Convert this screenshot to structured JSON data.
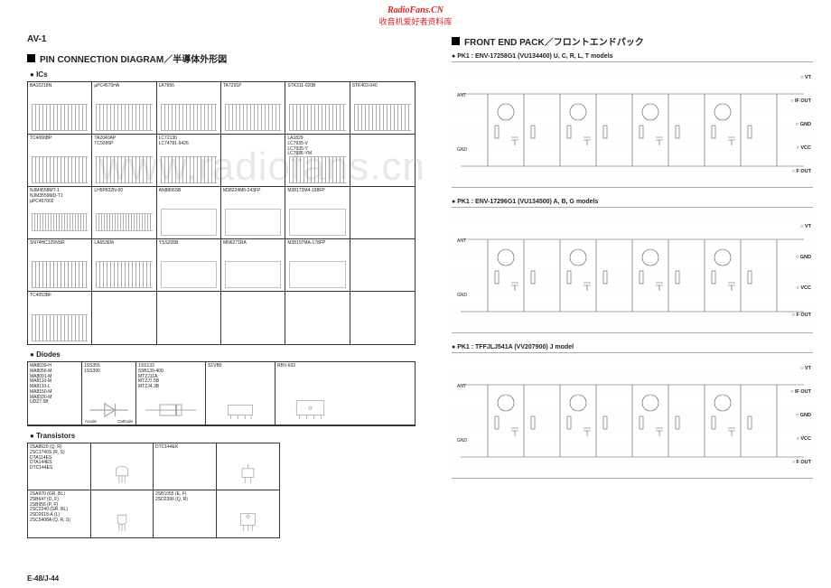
{
  "watermark": {
    "site": "RadioFans.CN",
    "tagline": "收音机爱好者资料库",
    "bg": "www.radiofans.cn"
  },
  "model": "AV-1",
  "page_footer": "E-48/J-44",
  "left": {
    "title": "PIN CONNECTION DIAGRAM／半導体外形図",
    "ic_heading": "ICs",
    "ic_rows": [
      [
        {
          "labels": [
            "BA10218N"
          ]
        },
        {
          "labels": [
            "µPC4570HA"
          ]
        },
        {
          "labels": [
            "LA7956"
          ]
        },
        {
          "labels": [
            "TA7291P"
          ]
        },
        {
          "labels": [
            "STK311-020B"
          ]
        },
        {
          "labels": [
            "STK403-040"
          ]
        }
      ],
      [
        {
          "labels": [
            "TC4066BP"
          ]
        },
        {
          "labels": [
            "TA2040AP",
            "TC9286P"
          ]
        },
        {
          "labels": [
            "LC72130",
            "LC74781-9426"
          ]
        },
        {
          "labels": [
            ""
          ],
          "empty": true
        },
        {
          "labels": [
            "LA1829",
            "LC7935-V",
            "LC7935-Y",
            "LC7935-YM"
          ]
        },
        {
          "labels": [
            ""
          ],
          "empty": true
        }
      ],
      [
        {
          "labels": [
            "NJM4558MT-1",
            "NJM3559MD-T1",
            "µPC457002"
          ]
        },
        {
          "labels": [
            "LH5P832N-00"
          ]
        },
        {
          "labels": [
            "AN8806SB"
          ]
        },
        {
          "labels": [
            "M38224M6-243FP"
          ]
        },
        {
          "labels": [
            "M38172M4-198FP"
          ]
        },
        {
          "labels": [
            ""
          ],
          "empty": true
        }
      ],
      [
        {
          "labels": [
            "SN74HC125NSR"
          ]
        },
        {
          "labels": [
            "LA6536M"
          ]
        },
        {
          "labels": [
            "YSS205B"
          ]
        },
        {
          "labels": [
            "MN6271RA"
          ]
        },
        {
          "labels": [
            "M38197MA-178FP"
          ]
        },
        {
          "labels": [
            ""
          ],
          "empty": true
        }
      ],
      [
        {
          "labels": [
            "TC4053BF"
          ]
        },
        {
          "labels": [
            ""
          ],
          "empty": true
        },
        {
          "labels": [
            ""
          ],
          "empty": true
        },
        {
          "labels": [
            ""
          ],
          "empty": true
        },
        {
          "labels": [
            ""
          ],
          "empty": true
        },
        {
          "labels": [
            ""
          ],
          "empty": true
        }
      ]
    ],
    "diode_heading": "Diodes",
    "diodes": {
      "col1": [
        "MA8039-H",
        "MA8056-M",
        "MA8091-M",
        "MA8110-M",
        "MA8110-L",
        "MA8150-M",
        "MA8330-M",
        "UDZ7.5B"
      ],
      "col2": [
        "1SS355",
        "1SS390"
      ],
      "col3": [
        "1SS133",
        "S5B139-400",
        "MTZJ11A",
        "MTZJ7.5B",
        "MTZJ4.3B"
      ],
      "col4": "S1VB0",
      "col5": "RBV-602",
      "anode": "Anode",
      "cathode": "Cathode"
    },
    "tr_heading": "Transistors",
    "tr": {
      "r1c1": [
        "2SA8620 (Q, R)",
        "2SC1740S (R, S)",
        "DTA114ES",
        "DTA144ES",
        "DTC144ES"
      ],
      "r1c3": [
        "DTC144EK"
      ],
      "r2c1": [
        "2SA970 (GR, BL)",
        "2SB647 (D, F)",
        "2SB956 (P, F)",
        "2SC2240 (GR, BL)",
        "2SD2618-A (L)",
        "2SC5408A (Q, R, S)"
      ],
      "r2c3": [
        "2SB1055 (E, F)",
        "2SD2396 (Q, R)"
      ]
    }
  },
  "right": {
    "title": "FRONT END PACK／フロントエンドパック",
    "blocks": [
      {
        "title": "PK1 : ENV-17258G1 (VU134400) U, C, R, L, T models",
        "pins": [
          "VT",
          "IF OUT",
          "GND",
          "VCC",
          "F OUT"
        ]
      },
      {
        "title": "PK1 : ENV-17296G1 (VU134500) A, B, G models",
        "pins": [
          "VT",
          "GND",
          "VCC",
          "F OUT"
        ]
      },
      {
        "title": "PK1 : TFFJLJ541A (VV207900) J model",
        "pins": [
          "VT",
          "IF OUT",
          "GND",
          "VCC",
          "F OUT"
        ]
      }
    ],
    "ant_label": "ANT",
    "gnd_label": "GND"
  }
}
